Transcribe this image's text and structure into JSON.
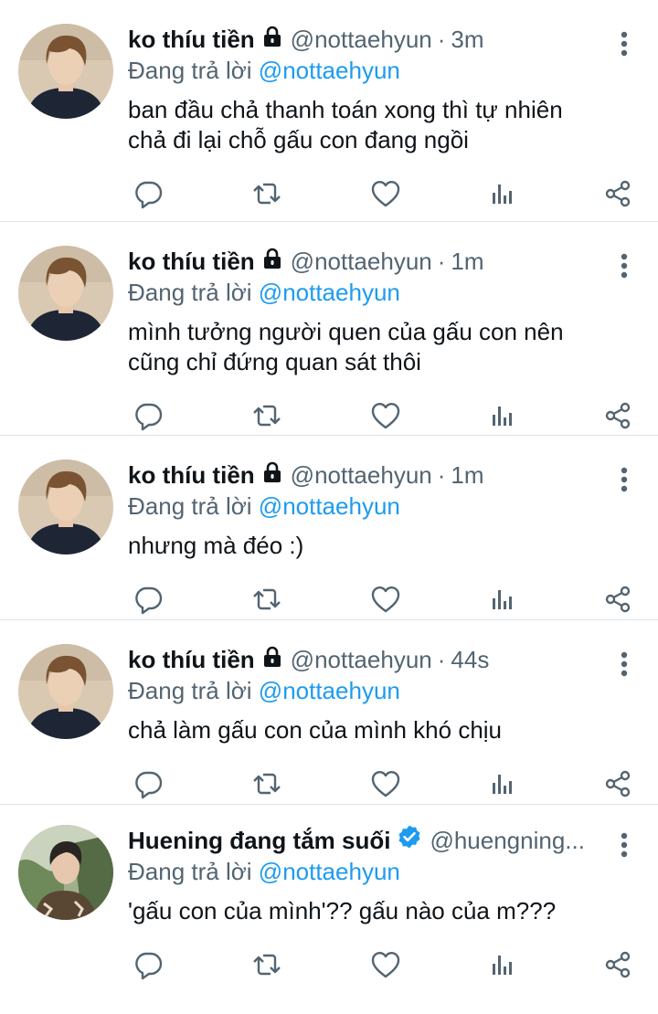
{
  "colors": {
    "text": "#0f1419",
    "secondary": "#536471",
    "link": "#1d9bf0",
    "verified": "#1d9bf0",
    "divider": "#dfe3e6"
  },
  "tweets": [
    {
      "name": "ko thíu tiền",
      "badge": "lock-icon",
      "handle": "@nottaehyun",
      "dot": "·",
      "time": "3m",
      "reply_prefix": "Đang trả lời",
      "reply_to": "@nottaehyun",
      "text": "ban đầu chả thanh toán xong thì tự nhiên\nchả đi lại chỗ gấu con đang ngồi"
    },
    {
      "name": "ko thíu tiền",
      "badge": "lock-icon",
      "handle": "@nottaehyun",
      "dot": "·",
      "time": "1m",
      "reply_prefix": "Đang trả lời",
      "reply_to": "@nottaehyun",
      "text": "mình tưởng người quen của gấu con nên\ncũng chỉ đứng quan sát thôi"
    },
    {
      "name": "ko thíu tiền",
      "badge": "lock-icon",
      "handle": "@nottaehyun",
      "dot": "·",
      "time": "1m",
      "reply_prefix": "Đang trả lời",
      "reply_to": "@nottaehyun",
      "text": "nhưng mà đéo :)"
    },
    {
      "name": "ko thíu tiền",
      "badge": "lock-icon",
      "handle": "@nottaehyun",
      "dot": "·",
      "time": "44s",
      "reply_prefix": "Đang trả lời",
      "reply_to": "@nottaehyun",
      "text": "chả làm gấu con của mình khó chịu"
    },
    {
      "name": "Huening đang tắm suối",
      "badge": "verified-icon",
      "handle": "@huengning...",
      "reply_prefix": "Đang trả lời",
      "reply_to": "@nottaehyun",
      "text": "'gấu con của mình'?? gấu nào của m???"
    }
  ],
  "icons": {
    "more": "more-vertical-icon",
    "reply": "reply-icon",
    "retweet": "retweet-icon",
    "like": "heart-icon",
    "views": "views-icon",
    "share": "share-icon"
  }
}
